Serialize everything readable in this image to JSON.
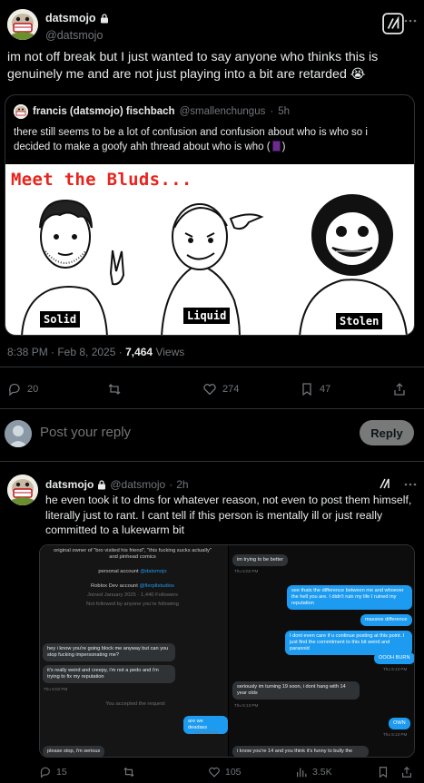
{
  "post": {
    "display_name": "datsmojo",
    "handle": "@datsmojo",
    "text": "im not off break but I just wanted to say anyone who thinks this is genuinely me and are not just playing into a bit are retarded 😭",
    "quote": {
      "display_name": "francis (datsmojo) fischbach",
      "handle": "@smallenchungus",
      "separator": "·",
      "time": "5h",
      "text_before": "there still seems to be a lot of confusion and confusion about who is who so i decided to make a goofy ahh thread about who is who (",
      "text_after": ")",
      "image": {
        "title": "Meet the Bluds...",
        "labels": [
          "Solid",
          "Liquid",
          "Stolen"
        ]
      }
    },
    "meta": {
      "time": "8:38 PM · Feb 8, 2025 ·",
      "views_count": "7,464",
      "views_label": "Views"
    },
    "actions": {
      "replies": "20",
      "retweets": "",
      "likes": "274",
      "bookmarks": "47"
    }
  },
  "composer": {
    "placeholder": "Post your reply",
    "reply_label": "Reply"
  },
  "reply": {
    "display_name": "datsmojo",
    "handle": "@datsmojo",
    "separator": "·",
    "time": "2h",
    "text": "he even took it to dms for whatever reason, not even to post them himself, literally just to rant. I cant tell if this person is mentally ill or just really committed to a lukewarm bit",
    "dm": {
      "profile_bio": "original owner of \"bro visited his friend\", \"this fucking sucks actually\" and pinhead comics",
      "personal_label": "personal account",
      "personal_handle": "@datsmojo",
      "roblox_label": "Roblox Dev account",
      "roblox_handle": "@flerpltstudios",
      "joined": "Joined January 2025 · 1,440 Followers",
      "not_followed": "Not followed by anyone you're following",
      "left_messages": [
        "hey i know you're going block me anyway but can you stop fucking impersonating me?",
        "it's really weird and creepy, i'm not a pedo and i'm trying to fix my reputation",
        "please stop, i'm serious"
      ],
      "left_time_1": "Thu 5:02 PM",
      "accepted": "You accepted the request",
      "left_blue": "are we deadass",
      "left_blue_time": "Thu 5:09 PM",
      "right_messages_gray": [
        "im trying to be better",
        "seriously im turning 19 soon, i dont hang with 14 year olds",
        "i know you're 14 and you think it's funny to bully the"
      ],
      "right_time_1": "Thu 5:02 PM",
      "right_time_2": "Thu 5:13 PM",
      "right_messages_blue": [
        "see thats the difference between me and whoever the hell you are. I didn't ruin my life I ruined my reputation",
        "massive difference",
        "I dont even care if u continue posting at this point. I just find the commitment to this bit weird and paranoid",
        "OOOH BURN",
        "OWN"
      ],
      "right_blue_time": "Thu 5:13 PM",
      "right_own_time": "Thu 5:13 PM"
    },
    "actions": {
      "replies": "15",
      "retweets": "",
      "likes": "105",
      "views": "3.5K"
    }
  },
  "colors": {
    "background": "#000000",
    "text": "#e7e9ea",
    "muted": "#71767b",
    "border": "#2f3336",
    "accent": "#1d9bf0",
    "meme_title": "#e8241c"
  },
  "icons": [
    "lock-icon",
    "grok-icon",
    "more-icon",
    "reply-icon",
    "retweet-icon",
    "like-icon",
    "bookmark-icon",
    "views-icon",
    "share-icon"
  ]
}
